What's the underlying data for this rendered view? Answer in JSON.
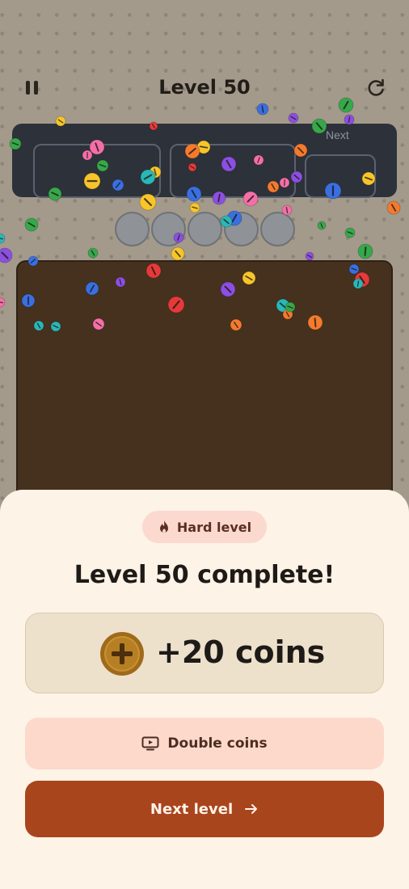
{
  "header": {
    "title": "Level 50",
    "pause_icon": "pause-icon",
    "restart_icon": "restart-icon"
  },
  "tray": {
    "next_label": "Next"
  },
  "result": {
    "badge_icon": "fire-icon",
    "badge_label": "Hard level",
    "title": "Level 50 complete!",
    "coin_icon": "plus-coin-icon",
    "reward": "+20 coins",
    "double_icon": "tv-ad-icon",
    "double_label": "Double coins",
    "next_label": "Next level",
    "next_icon": "arrow-right-icon"
  },
  "colors": {
    "background": "#a39a8c",
    "tray": "#2d323a",
    "board": "#46311f",
    "sheet": "#fdf3e6",
    "primary_button": "#a9451d",
    "secondary_button": "#fcd9cb",
    "screw_colors": [
      "#e63a3a",
      "#f7c52b",
      "#3b6fe0",
      "#8c4fe0",
      "#f46fa8",
      "#f47a2e",
      "#2ab7b7",
      "#37a84a"
    ]
  }
}
